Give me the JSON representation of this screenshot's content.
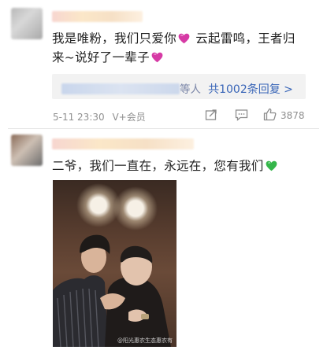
{
  "comments": [
    {
      "text_line1": "我是唯粉，我们只爱你",
      "text_line1_after": "云起雷鸣，王者归",
      "text_line2": "来~说好了一辈子",
      "reply": {
        "suffix": "等人",
        "link_text": "共1002条回复 >"
      },
      "date": "5-11 23:30",
      "vip": "V+会员",
      "like_count": "3878"
    },
    {
      "text": "二爷，我们一直在，永远在，您有我们"
    }
  ],
  "photo": {
    "watermark": "@阳光惠农生态惠农有"
  },
  "colors": {
    "heart_pink": "#d63aa5",
    "heart_green": "#35b64a",
    "link_blue": "#3a66b8",
    "reply_bg": "#f2f2f2"
  },
  "icons": [
    "share-icon",
    "comment-icon",
    "like-icon",
    "heart-pink-icon",
    "heart-green-icon"
  ]
}
